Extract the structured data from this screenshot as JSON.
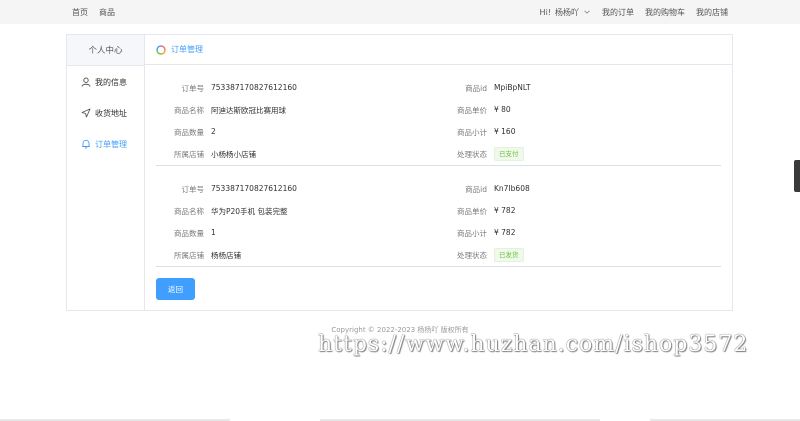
{
  "topnav": {
    "home": "首页",
    "products": "商品",
    "greeting": "Hi!",
    "username": "杨杨吖",
    "my_orders": "我的订单",
    "my_cart": "我的购物车",
    "my_store": "我的店铺"
  },
  "sidebar": {
    "title": "个人中心",
    "items": [
      {
        "label": "我的信息",
        "icon": "user-icon",
        "active": false
      },
      {
        "label": "收货地址",
        "icon": "location-arrow-icon",
        "active": false
      },
      {
        "label": "订单管理",
        "icon": "bell-icon",
        "active": true
      }
    ]
  },
  "main": {
    "title": "订单管理",
    "back_button": "返回"
  },
  "labels": {
    "order_no": "订单号",
    "product_name": "商品名称",
    "quantity": "商品数量",
    "store": "所属店铺",
    "product_id": "商品id",
    "unit_price": "商品单价",
    "subtotal": "商品小计",
    "status": "处理状态"
  },
  "orders": [
    {
      "order_no": "753387170827612160",
      "product_name": "阿迪达斯欧冠比赛用球",
      "quantity": "2",
      "store": "小杨杨小店铺",
      "product_id": "MpiBpNLT",
      "unit_price": "¥ 80",
      "subtotal": "¥ 160",
      "status": "已支付"
    },
    {
      "order_no": "753387170827612160",
      "product_name": "华为P20手机 包装完整",
      "quantity": "1",
      "store": "杨杨店铺",
      "product_id": "Kn7Ib608",
      "unit_price": "¥ 782",
      "subtotal": "¥ 782",
      "status": "已发货"
    }
  ],
  "footer": {
    "copyright": "Copyright © 2022-2023 杨杨吖 版权所有"
  },
  "watermark": {
    "text": "https://www.huzhan.com/ishop3572"
  },
  "colors": {
    "primary": "#409eff",
    "success_text": "#67c23a",
    "success_bg": "#f0f9eb",
    "topbar_bg": "#f5f5f5"
  }
}
